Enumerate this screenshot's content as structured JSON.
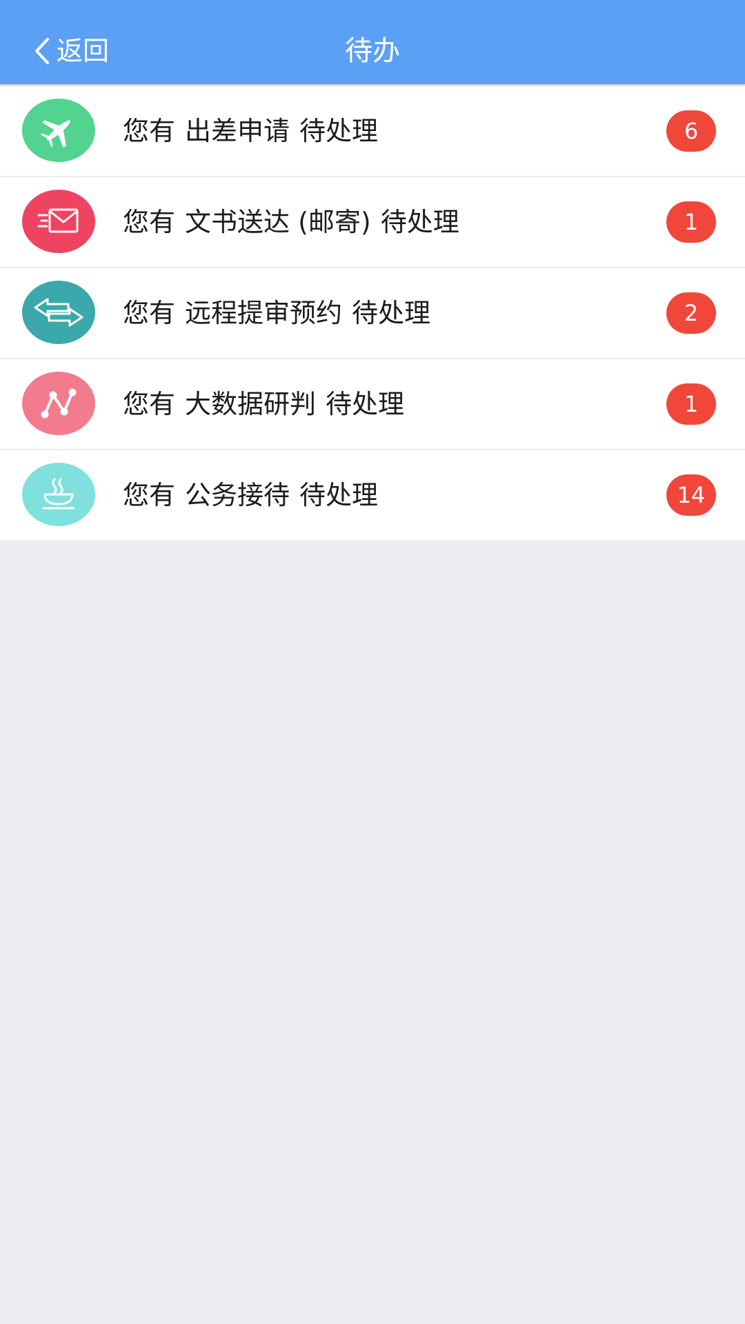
{
  "header": {
    "back_label": "返回",
    "title": "待办",
    "background_color": "#5ba0f5"
  },
  "todo_items": [
    {
      "prefix": "您有",
      "category": "出差申请",
      "suffix": "待处理",
      "count": "6",
      "icon": "airplane-icon",
      "icon_color": "#52d38f"
    },
    {
      "prefix": "您有",
      "category": "文书送达 (邮寄)",
      "suffix": "待处理",
      "count": "1",
      "icon": "mail-icon",
      "icon_color": "#ee4461"
    },
    {
      "prefix": "您有",
      "category": "远程提审预约",
      "suffix": "待处理",
      "count": "2",
      "icon": "swap-arrows-icon",
      "icon_color": "#3ba8ab"
    },
    {
      "prefix": "您有",
      "category": "大数据研判",
      "suffix": "待处理",
      "count": "1",
      "icon": "line-graph-icon",
      "icon_color": "#f27c8d"
    },
    {
      "prefix": "您有",
      "category": "公务接待",
      "suffix": "待处理",
      "count": "14",
      "icon": "tea-cup-icon",
      "icon_color": "#7fe0de"
    }
  ],
  "colors": {
    "badge": "#f0473a",
    "page_background": "#efedf1"
  }
}
